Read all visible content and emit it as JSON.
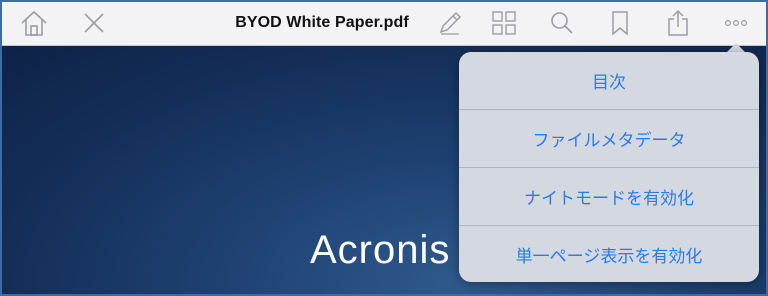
{
  "toolbar": {
    "title": "BYOD White Paper.pdf",
    "icons": {
      "home": "home-icon",
      "close": "close-icon",
      "annotate": "pencil-icon",
      "thumbnails": "grid-icon",
      "search": "search-icon",
      "bookmark": "bookmark-icon",
      "share": "share-icon",
      "more": "more-icon"
    }
  },
  "document": {
    "brand_text": "Acronis"
  },
  "menu": {
    "items": [
      {
        "label": "目次"
      },
      {
        "label": "ファイルメタデータ"
      },
      {
        "label": "ナイトモードを有効化"
      },
      {
        "label": "単一ページ表示を有効化"
      }
    ]
  },
  "colors": {
    "accent": "#2a7be6",
    "frame_border": "#3e6aa5",
    "doc_background": "#142e58",
    "toolbar_icon": "#a0a0a8"
  }
}
